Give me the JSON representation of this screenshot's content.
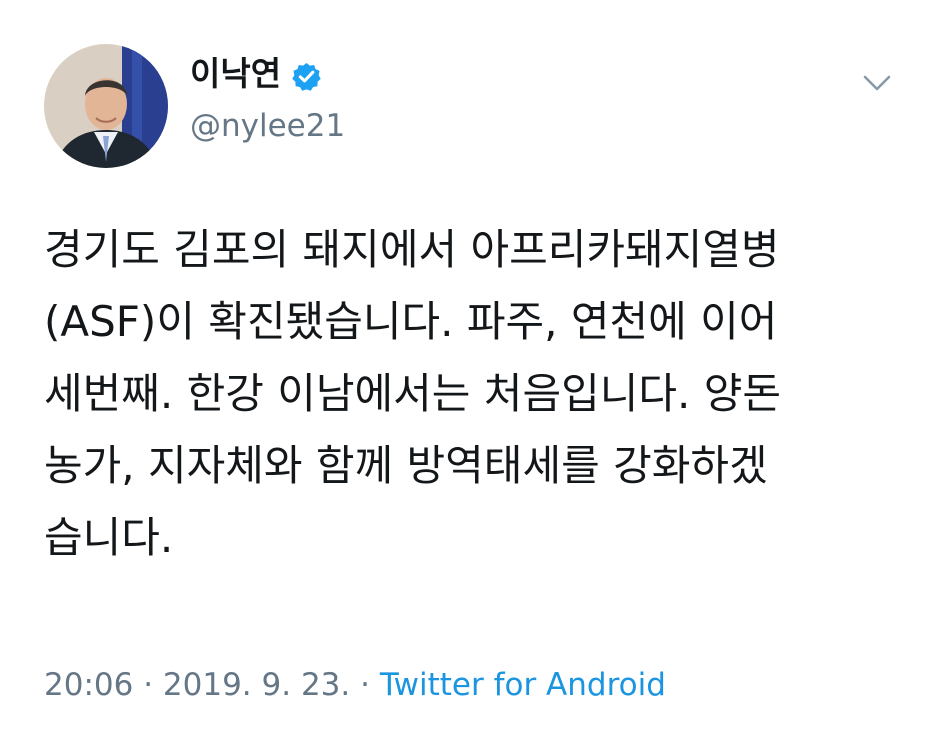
{
  "author": {
    "display_name": "이낙연",
    "handle": "@nylee21",
    "verified": true,
    "avatar_icon": "profile-photo"
  },
  "menu": {
    "icon": "chevron-down-icon"
  },
  "tweet": {
    "lines": [
      "경기도 김포의 돼지에서 아프리카돼지열병",
      "(ASF)이 확진됐습니다. 파주, 연천에 이어",
      "세번째. 한강 이남에서는 처음입니다. 양돈",
      "농가, 지자체와 함께 방역태세를 강화하겠",
      "습니다."
    ]
  },
  "meta": {
    "time": "20:06",
    "separator1": " · ",
    "date": "2019. 9. 23.",
    "separator2": " · ",
    "source": "Twitter for Android"
  },
  "colors": {
    "verified_blue": "#1da1f2",
    "link_blue": "#1b95e0",
    "secondary_gray": "#657786",
    "text_dark": "#14171a"
  }
}
